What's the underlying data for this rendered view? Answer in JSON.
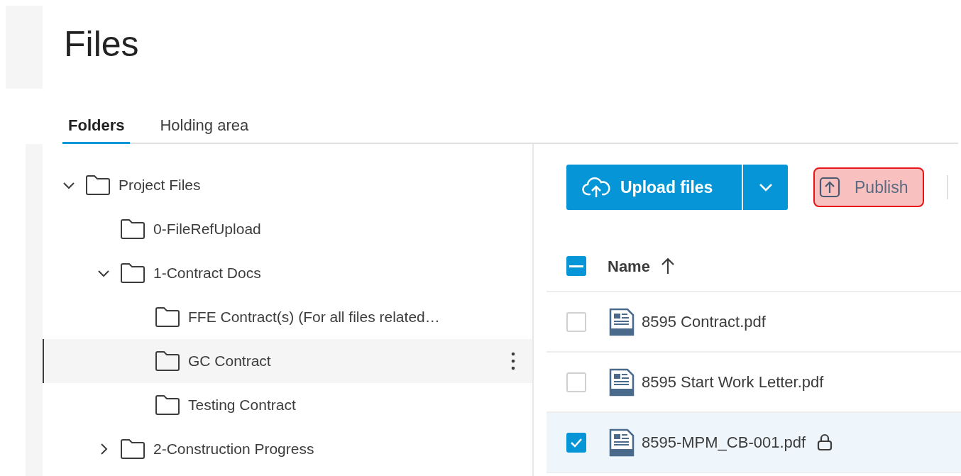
{
  "page": {
    "title": "Files"
  },
  "tabs": [
    {
      "label": "Folders",
      "selected": true
    },
    {
      "label": "Holding area",
      "selected": false
    }
  ],
  "tree": [
    {
      "label": "Project Files",
      "expanded": true,
      "selected": false,
      "children": [
        {
          "label": "0-FileRefUpload",
          "selected": false
        },
        {
          "label": "1-Contract Docs",
          "expanded": true,
          "selected": false,
          "children": [
            {
              "label": "FFE Contract(s) (For all files related…",
              "selected": false
            },
            {
              "label": "GC Contract",
              "selected": true
            },
            {
              "label": "Testing Contract",
              "selected": false
            }
          ]
        },
        {
          "label": "2-Construction Progress",
          "expanded": false,
          "selected": false
        }
      ]
    }
  ],
  "toolbar": {
    "upload": {
      "label": "Upload files"
    },
    "publish": {
      "label": "Publish",
      "highlighted": true
    }
  },
  "table": {
    "select_all": {
      "indeterminate": true
    },
    "columns": [
      {
        "label": "Name",
        "sorted_ascending": true
      }
    ],
    "rows": [
      {
        "name": "8595 Contract.pdf",
        "checked": false,
        "selected": false,
        "locked": false
      },
      {
        "name": "8595 Start Work Letter.pdf",
        "checked": false,
        "selected": false,
        "locked": false
      },
      {
        "name": "8595-MPM_CB-001.pdf",
        "checked": true,
        "selected": true,
        "locked": true
      }
    ]
  }
}
